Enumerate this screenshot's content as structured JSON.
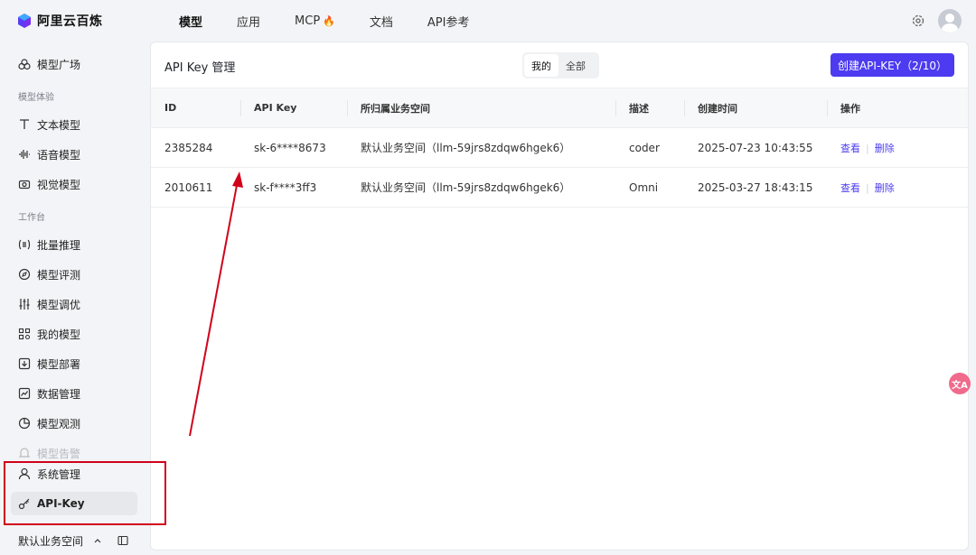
{
  "brand": {
    "name": "阿里云百炼"
  },
  "nav": {
    "items": [
      {
        "label": "模型"
      },
      {
        "label": "应用"
      },
      {
        "label": "MCP"
      },
      {
        "label": "文档"
      },
      {
        "label": "API参考"
      }
    ],
    "fire_glyph": "🔥"
  },
  "sidebar": {
    "top_item": "模型广场",
    "group1": "模型体验",
    "experience": [
      "文本模型",
      "语音模型",
      "视觉模型"
    ],
    "group2": "工作台",
    "workbench": [
      "批量推理",
      "模型评测",
      "模型调优",
      "我的模型",
      "模型部署",
      "数据管理",
      "模型观测",
      "模型告警"
    ],
    "system": "系统管理",
    "apikey": "API-Key",
    "workspace": "默认业务空间"
  },
  "main": {
    "title": "API Key 管理",
    "seg": [
      "我的",
      "全部"
    ],
    "create_button": "创建API-KEY（2/10）",
    "columns": [
      "ID",
      "API Key",
      "所归属业务空间",
      "描述",
      "创建时间",
      "操作"
    ],
    "rows": [
      {
        "id": "2385284",
        "key": "sk-6****8673",
        "space": "默认业务空间（llm-59jrs8zdqw6hgek6）",
        "desc": "coder",
        "time": "2025-07-23 10:43:55",
        "view": "查看",
        "del": "删除"
      },
      {
        "id": "2010611",
        "key": "sk-f****3ff3",
        "space": "默认业务空间（llm-59jrs8zdqw6hgek6）",
        "desc": "Omni",
        "time": "2025-03-27 18:43:15",
        "view": "查看",
        "del": "删除"
      }
    ]
  },
  "float": {
    "label": "文A"
  },
  "colors": {
    "accent": "#4c3bf0",
    "annotation": "#d0021b"
  }
}
